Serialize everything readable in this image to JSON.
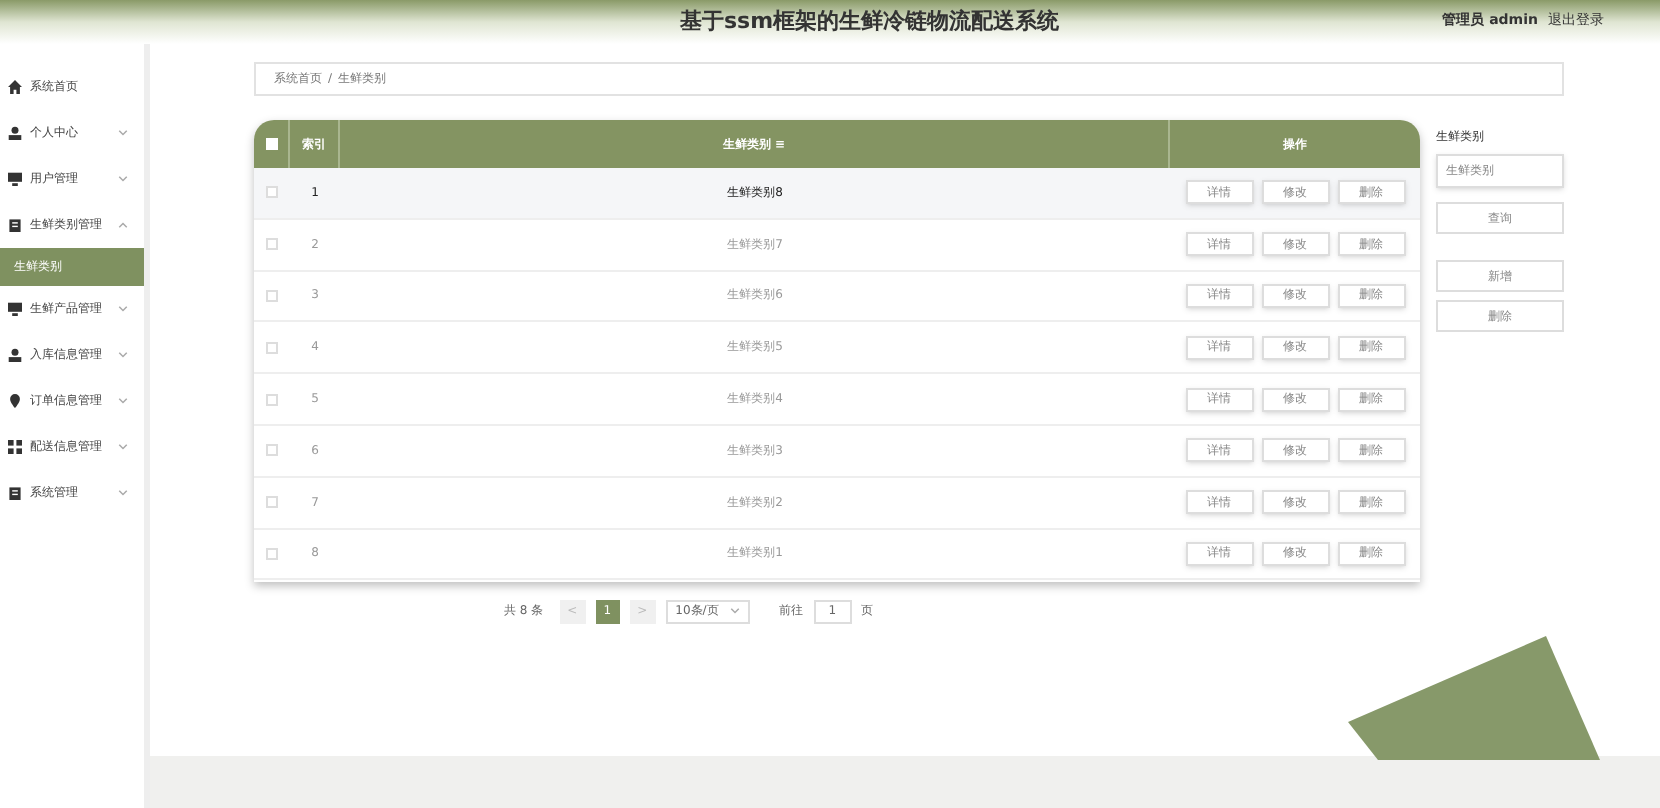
{
  "header": {
    "title": "基于ssm框架的生鲜冷链物流配送系统",
    "user": "管理员 admin",
    "logout": "退出登录"
  },
  "sidebar": {
    "items": [
      {
        "label": "系统首页"
      },
      {
        "label": "个人中心",
        "expanded": false
      },
      {
        "label": "用户管理",
        "expanded": false
      },
      {
        "label": "生鲜类别管理",
        "expanded": true,
        "children": [
          {
            "label": "生鲜类别",
            "selected": true
          }
        ]
      },
      {
        "label": "生鲜产品管理",
        "expanded": false
      },
      {
        "label": "入库信息管理",
        "expanded": false
      },
      {
        "label": "订单信息管理",
        "expanded": false
      },
      {
        "label": "配送信息管理",
        "expanded": false
      },
      {
        "label": "系统管理",
        "expanded": false
      }
    ]
  },
  "breadcrumb": [
    "系统首页",
    "/",
    "生鲜类别"
  ],
  "table": {
    "select_all_checked": false,
    "columns": [
      "索引",
      "生鲜类别 ≡",
      "操作"
    ],
    "rows": [
      {
        "checked": false,
        "index": "1",
        "name": "生鲜类别8",
        "hovered": true,
        "actions": [
          "详情",
          "修改",
          "删除"
        ]
      },
      {
        "checked": false,
        "index": "2",
        "name": "生鲜类别7",
        "hovered": false,
        "actions": [
          "详情",
          "修改",
          "删除"
        ]
      },
      {
        "checked": false,
        "index": "3",
        "name": "生鲜类别6",
        "hovered": false,
        "actions": [
          "详情",
          "修改",
          "删除"
        ]
      },
      {
        "checked": false,
        "index": "4",
        "name": "生鲜类别5",
        "hovered": false,
        "actions": [
          "详情",
          "修改",
          "删除"
        ]
      },
      {
        "checked": false,
        "index": "5",
        "name": "生鲜类别4",
        "hovered": false,
        "actions": [
          "详情",
          "修改",
          "删除"
        ]
      },
      {
        "checked": false,
        "index": "6",
        "name": "生鲜类别3",
        "hovered": false,
        "actions": [
          "详情",
          "修改",
          "删除"
        ]
      },
      {
        "checked": false,
        "index": "7",
        "name": "生鲜类别2",
        "hovered": false,
        "actions": [
          "详情",
          "修改",
          "删除"
        ]
      },
      {
        "checked": false,
        "index": "8",
        "name": "生鲜类别1",
        "hovered": false,
        "actions": [
          "详情",
          "修改",
          "删除"
        ]
      }
    ]
  },
  "pagination": {
    "total": "共 8 条",
    "prev": "<",
    "pages": [
      {
        "label": "1",
        "selected": true
      }
    ],
    "next": ">",
    "page_size": "10条/页",
    "goto_label": "前往",
    "goto_value": "1",
    "goto_unit": "页"
  },
  "search": {
    "label": "生鲜类别",
    "placeholder": "生鲜类别",
    "buttons": [
      "查询",
      "新增",
      "删除"
    ]
  }
}
